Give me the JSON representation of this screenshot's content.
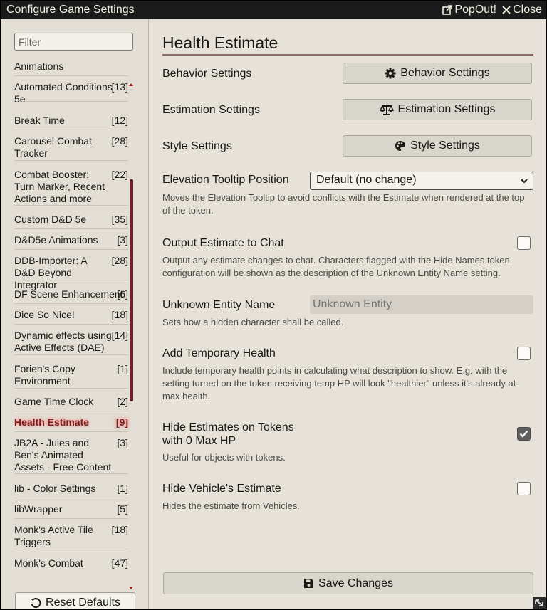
{
  "window": {
    "title": "Configure Game Settings",
    "popout_label": "PopOut!",
    "close_label": "Close"
  },
  "sidebar": {
    "filter_placeholder": "Filter",
    "categories": [
      {
        "name": "Animations",
        "count": ""
      },
      {
        "name": "Automated Conditions 5e",
        "count": "[13]"
      },
      {
        "name": "Break Time",
        "count": "[12]"
      },
      {
        "name": "Carousel Combat Tracker",
        "count": "[28]"
      },
      {
        "name": "Combat Booster: Turn Marker, Recent Actions and more",
        "count": "[22]"
      },
      {
        "name": "Custom D&D 5e",
        "count": "[35]"
      },
      {
        "name": "D&D5e Animations",
        "count": "[3]"
      },
      {
        "name": "DDB-Importer: A D&D Beyond Integrator",
        "count": "[28]"
      },
      {
        "name": "DF Scene Enhancement",
        "count": "[6]"
      },
      {
        "name": "Dice So Nice!",
        "count": "[18]"
      },
      {
        "name": "Dynamic effects using Active Effects (DAE)",
        "count": "[14]"
      },
      {
        "name": "Forien's Copy Environment",
        "count": "[1]"
      },
      {
        "name": "Game Time Clock",
        "count": "[2]"
      },
      {
        "name": "Health Estimate",
        "count": "[9]"
      },
      {
        "name": "JB2A - Jules and Ben's Animated Assets - Free Content",
        "count": "[3]"
      },
      {
        "name": "lib - Color Settings",
        "count": "[1]"
      },
      {
        "name": "libWrapper",
        "count": "[5]"
      },
      {
        "name": "Monk's Active Tile Triggers",
        "count": "[18]"
      },
      {
        "name": "Monk's Combat Details",
        "count": "[47]"
      }
    ],
    "active_category": "Health Estimate",
    "reset_label": "Reset Defaults"
  },
  "main": {
    "heading": "Health Estimate",
    "behavior": {
      "label": "Behavior Settings",
      "button": "Behavior Settings"
    },
    "estimation": {
      "label": "Estimation Settings",
      "button": "Estimation Settings"
    },
    "style": {
      "label": "Style Settings",
      "button": "Style Settings"
    },
    "elevation": {
      "label": "Elevation Tooltip Position",
      "value": "Default (no change)",
      "note": "Moves the Elevation Tooltip to avoid conflicts with the Estimate when rendered at the top of the token."
    },
    "output_chat": {
      "label": "Output Estimate to Chat",
      "checked": false,
      "note": "Output any estimate changes to chat. Characters flagged with the Hide Names token configuration will be shown as the description of the Unknown Entity Name setting."
    },
    "unknown_entity": {
      "label": "Unknown Entity Name",
      "placeholder": "Unknown Entity",
      "note": "Sets how a hidden character shall be called."
    },
    "temp_health": {
      "label": "Add Temporary Health",
      "checked": false,
      "note": "Include temporary health points in calculating what description to show. E.g. with the setting turned on the token receiving temp HP will look \"healthier\" unless it's already at max health."
    },
    "hide_zero": {
      "label": "Hide Estimates on Tokens with 0 Max HP",
      "checked": true,
      "note": "Useful for objects with tokens."
    },
    "hide_vehicle": {
      "label": "Hide Vehicle's Estimate",
      "checked": false,
      "note": "Hides the estimate from Vehicles."
    },
    "save_label": "Save Changes"
  },
  "colors": {
    "titlebar_bg": "#1b1b1b",
    "active_category": "#7a1c1c",
    "scrollbar": "#6d1f2c",
    "panel_bg": "#e6e2d9"
  }
}
